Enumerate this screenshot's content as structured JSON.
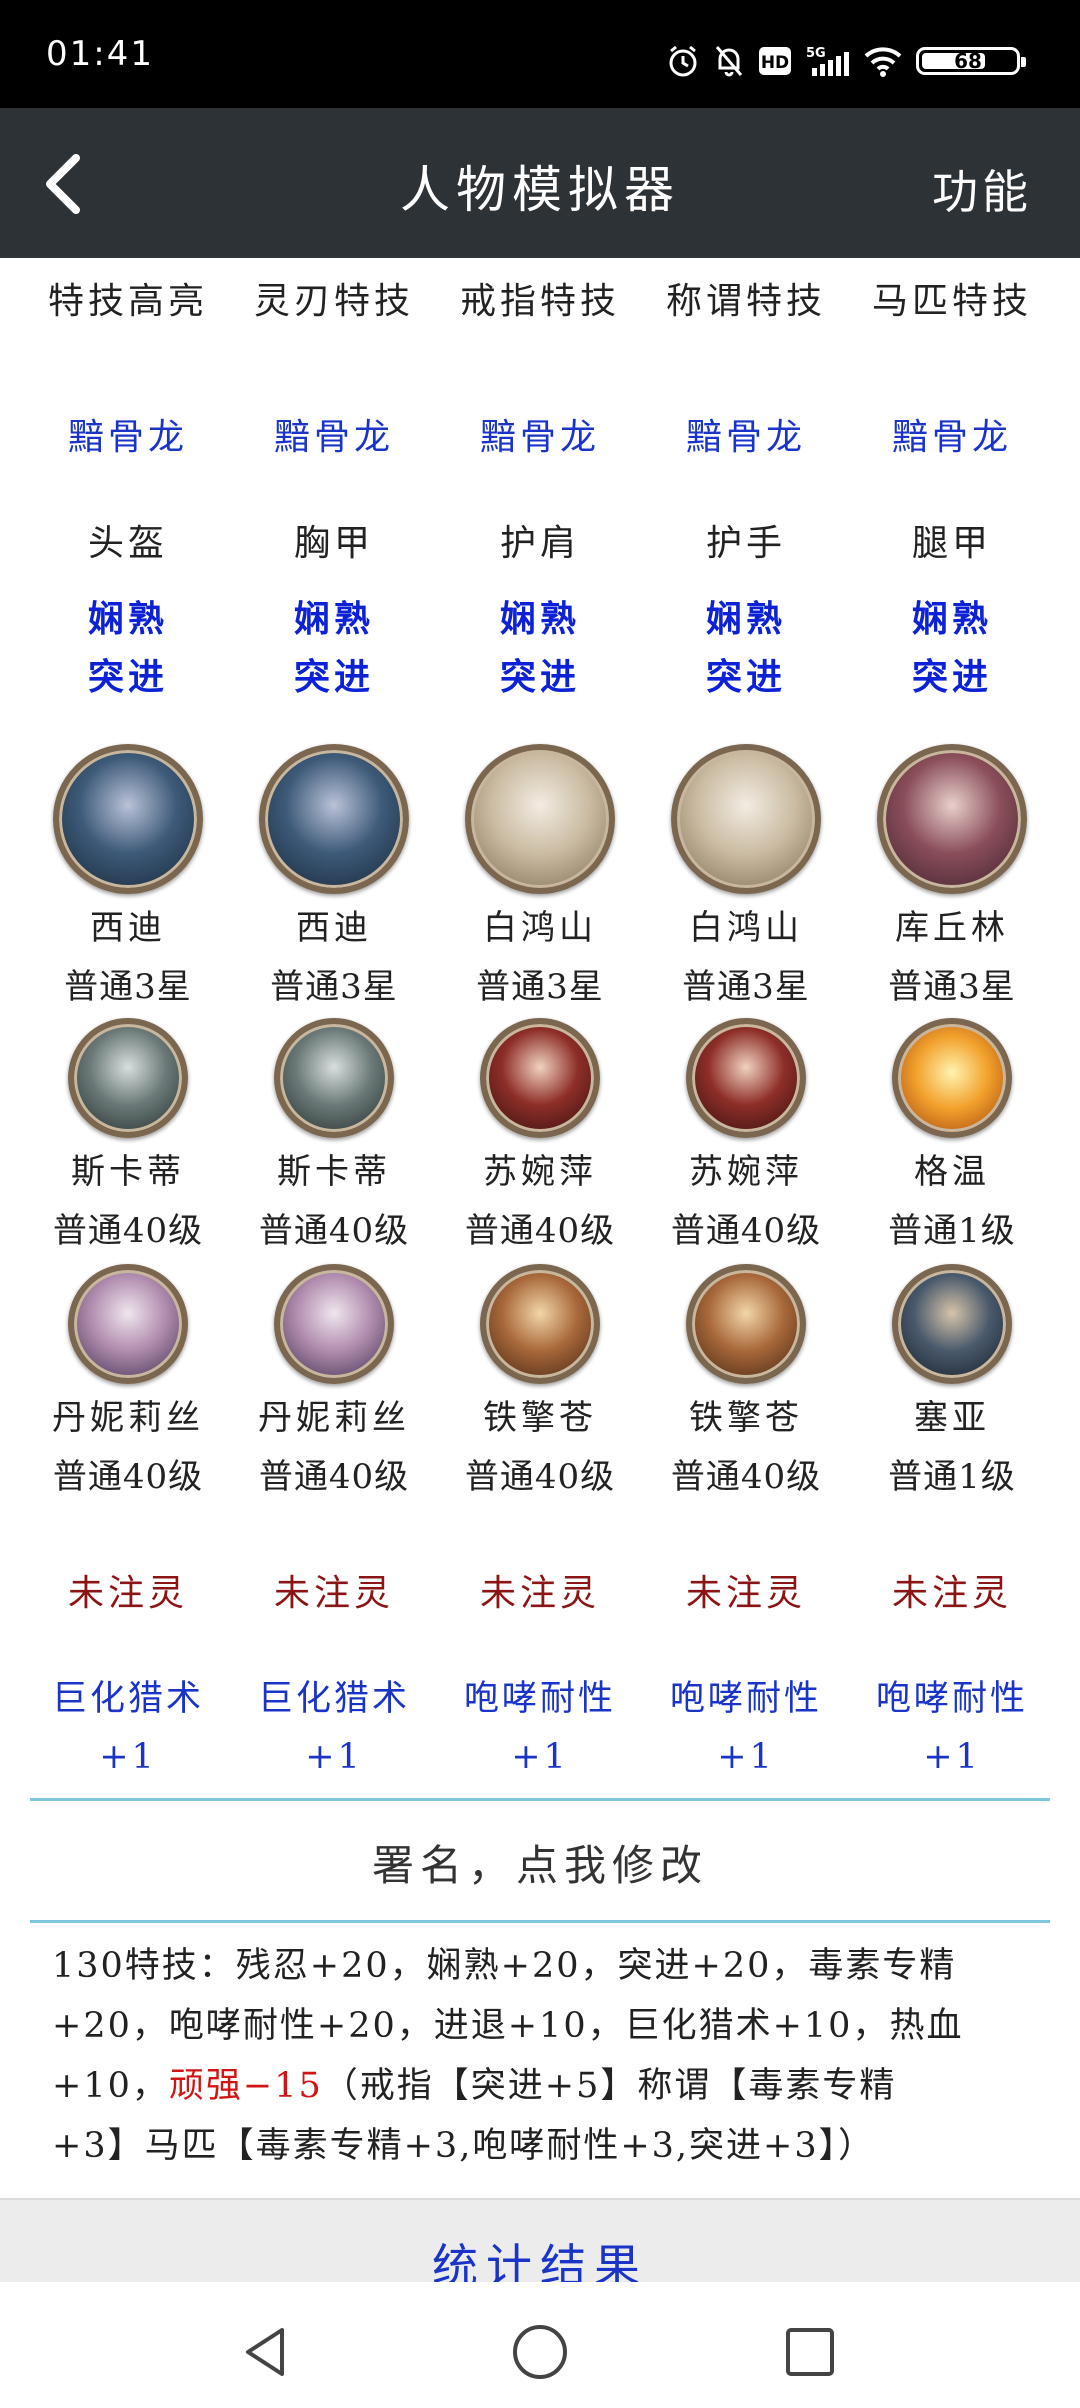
{
  "status_bar": {
    "time": "01:41",
    "battery": "68",
    "battery_level": 0.68,
    "network": "5G"
  },
  "header": {
    "title": "人物模拟器",
    "function": "功能"
  },
  "columns": [
    {
      "skill_type": "特技高亮",
      "skill": "黯骨龙",
      "equip_slot": "头盔",
      "equip_trait_1": "娴熟",
      "equip_trait_2": "突进",
      "hero1": {
        "name": "西迪",
        "level": "普通3星",
        "icon": "portrait-sidi"
      },
      "hero2": {
        "name": "斯卡蒂",
        "level": "普通40级",
        "icon": "portrait-skadi"
      },
      "hero3": {
        "name": "丹妮莉丝",
        "level": "普通40级",
        "icon": "portrait-danielis"
      },
      "spirit": "未注灵",
      "bonus_skill": "巨化猎术",
      "bonus": "+1"
    },
    {
      "skill_type": "灵刃特技",
      "skill": "黯骨龙",
      "equip_slot": "胸甲",
      "equip_trait_1": "娴熟",
      "equip_trait_2": "突进",
      "hero1": {
        "name": "西迪",
        "level": "普通3星",
        "icon": "portrait-sidi"
      },
      "hero2": {
        "name": "斯卡蒂",
        "level": "普通40级",
        "icon": "portrait-skadi"
      },
      "hero3": {
        "name": "丹妮莉丝",
        "level": "普通40级",
        "icon": "portrait-danielis"
      },
      "spirit": "未注灵",
      "bonus_skill": "巨化猎术",
      "bonus": "+1"
    },
    {
      "skill_type": "戒指特技",
      "skill": "黯骨龙",
      "equip_slot": "护肩",
      "equip_trait_1": "娴熟",
      "equip_trait_2": "突进",
      "hero1": {
        "name": "白鸿山",
        "level": "普通3星",
        "icon": "portrait-baihongshan"
      },
      "hero2": {
        "name": "苏婉萍",
        "level": "普通40级",
        "icon": "portrait-suwanping"
      },
      "hero3": {
        "name": "铁擎苍",
        "level": "普通40级",
        "icon": "portrait-tieqingcang"
      },
      "spirit": "未注灵",
      "bonus_skill": "咆哮耐性",
      "bonus": "+1"
    },
    {
      "skill_type": "称谓特技",
      "skill": "黯骨龙",
      "equip_slot": "护手",
      "equip_trait_1": "娴熟",
      "equip_trait_2": "突进",
      "hero1": {
        "name": "白鸿山",
        "level": "普通3星",
        "icon": "portrait-baihongshan"
      },
      "hero2": {
        "name": "苏婉萍",
        "level": "普通40级",
        "icon": "portrait-suwanping"
      },
      "hero3": {
        "name": "铁擎苍",
        "level": "普通40级",
        "icon": "portrait-tieqingcang"
      },
      "spirit": "未注灵",
      "bonus_skill": "咆哮耐性",
      "bonus": "+1"
    },
    {
      "skill_type": "马匹特技",
      "skill": "黯骨龙",
      "equip_slot": "腿甲",
      "equip_trait_1": "娴熟",
      "equip_trait_2": "突进",
      "hero1": {
        "name": "库丘林",
        "level": "普通3星",
        "icon": "portrait-kuqiulin"
      },
      "hero2": {
        "name": "格温",
        "level": "普通1级",
        "icon": "portrait-gewen"
      },
      "hero3": {
        "name": "塞亚",
        "level": "普通1级",
        "icon": "portrait-saiya"
      },
      "spirit": "未注灵",
      "bonus_skill": "咆哮耐性",
      "bonus": "+1"
    }
  ],
  "signature": "署名，点我修改",
  "summary": {
    "line1": "130特技：残忍+20，娴熟+20，突进+20，毒素专精",
    "line2": "+20，咆哮耐性+20，进退+10，巨化猎术+10，热血",
    "line3_pre": "+10，",
    "line3_highlight": "顽强−15",
    "line3_post": "（戒指【突进+5】称谓【毒素专精",
    "line4": "+3】马匹【毒素专精+3,咆哮耐性+3,突进+3】）"
  },
  "stats_button": "统计结果",
  "colors": {
    "header_bg": "#2d3236",
    "accent_blue": "#1a34c8",
    "spirit_red": "#8b1414",
    "highlight_red": "#d21414",
    "divider": "#7ec6dc"
  }
}
